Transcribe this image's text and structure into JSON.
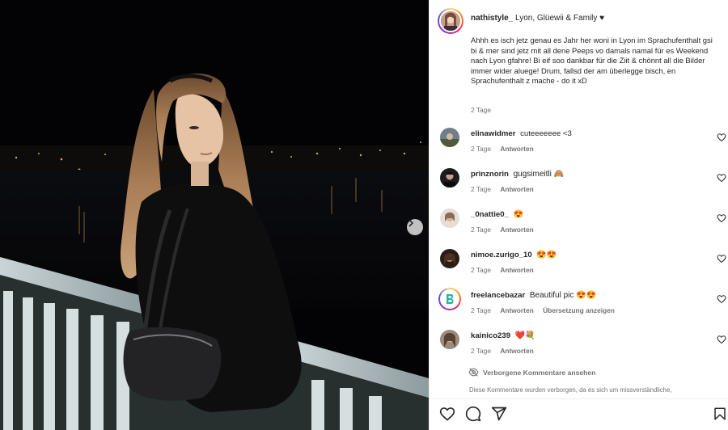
{
  "photo": {
    "next_icon": "chevron-right-icon"
  },
  "post": {
    "username": "nathistyle_",
    "location": "Lyon, Glüewii & Family ♥",
    "caption": "Ahhh es isch jetz genau es Jahr her woni in Lyon im Sprachufenthalt gsi bi & mer sind jetz mit all dene Peeps vo damals namal für es Weekend nach Lyon gfahre! Bi eif soo dankbar für die Ziit & chönnt all die Bilder immer wider aluege! Drum, fallsd der am überlegge bisch, en Sprachufenthalt z mache - do it xD",
    "time": "2 Tage"
  },
  "comments": [
    {
      "username": "elinawidmer",
      "text": "cuteeeeeee <3",
      "time": "2 Tage",
      "reply": "Antworten",
      "translate": "",
      "avatar_color": "#6d7f8c"
    },
    {
      "username": "prinznorin",
      "text": "gugsimeitli 🙈",
      "time": "2 Tage",
      "reply": "Antworten",
      "translate": "",
      "avatar_color": "#1c1c1c"
    },
    {
      "username": "_0nattie0_",
      "text": "😍",
      "time": "2 Tage",
      "reply": "Antworten",
      "translate": "",
      "avatar_color": "#b9a08c"
    },
    {
      "username": "nimoe.zurigo_10",
      "text": "😍😍",
      "time": "2 Tage",
      "reply": "Antworten",
      "translate": "",
      "avatar_color": "#3a2a1e"
    },
    {
      "username": "freelancebazar",
      "text": "Beautiful pic 😍😍",
      "time": "2 Tage",
      "reply": "Antworten",
      "translate": "Übersetzung anzeigen",
      "avatar_color": "#ffffff"
    },
    {
      "username": "kainico239",
      "text": "❤️💐",
      "time": "2 Tage",
      "reply": "Antworten",
      "translate": "",
      "avatar_color": "#8a7a6e"
    }
  ],
  "hidden": {
    "label": "Verborgene Kommentare ansehen",
    "note": "Diese Kommentare wurden verborgen, da es sich um missverständliche,"
  },
  "actions": {
    "like_icon": "heart-icon",
    "comment_icon": "comment-icon",
    "share_icon": "share-icon",
    "save_icon": "bookmark-icon"
  },
  "colors": {
    "text": "#262626",
    "muted": "#737373",
    "divider": "#efefef",
    "freelancebazar_badge": "#2bb3a0"
  }
}
